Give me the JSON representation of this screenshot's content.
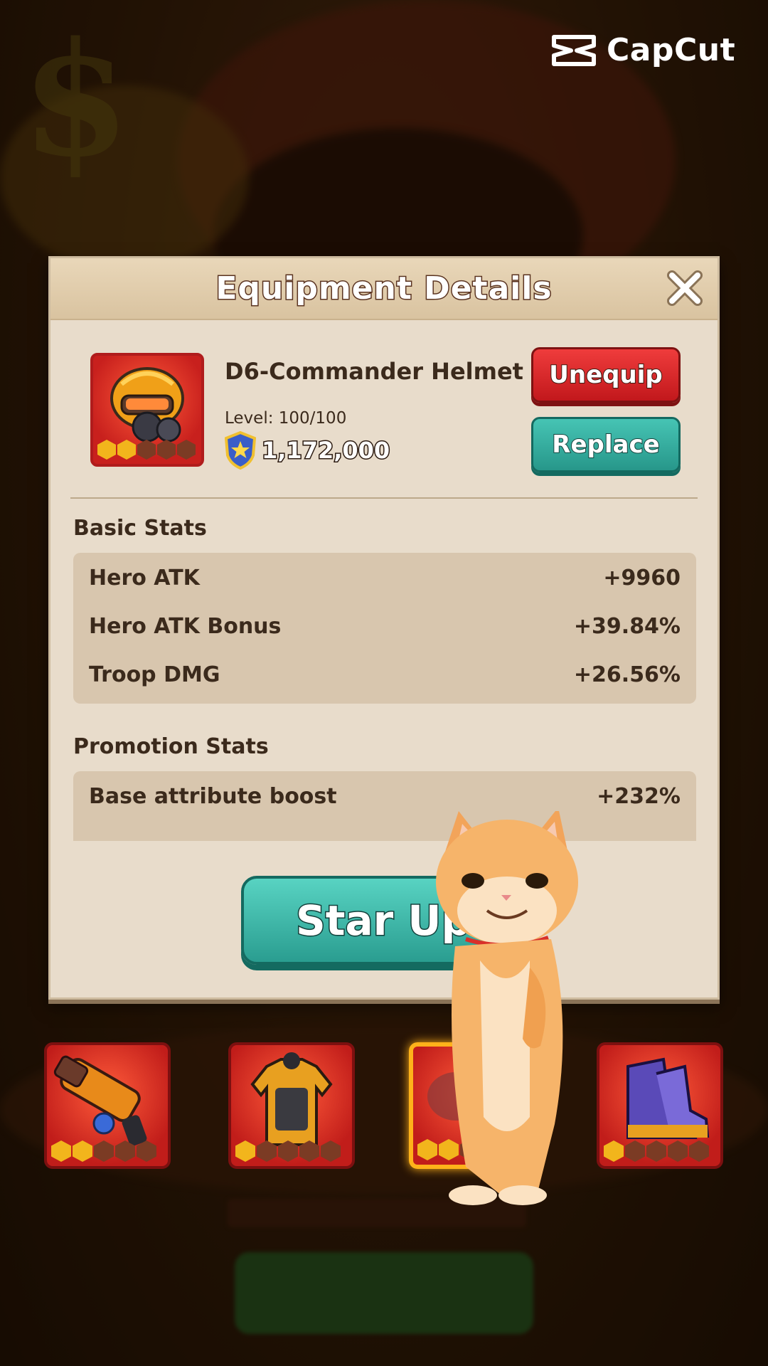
{
  "watermark": {
    "brand": "CapCut",
    "icon": "capcut-logo-icon"
  },
  "dialog": {
    "title": "Equipment Details",
    "close_icon": "close-icon",
    "item": {
      "name": "D6-Commander Helmet",
      "level": "Level: 100/100",
      "power": "1,172,000",
      "power_icon": "shield-star-icon",
      "stars_filled": 2,
      "stars_total": 5
    },
    "buttons": {
      "unequip": "Unequip",
      "replace": "Replace",
      "star_up": "Star Up"
    },
    "basic_stats": {
      "title": "Basic Stats",
      "rows": [
        {
          "label": "Hero ATK",
          "value": "+9960"
        },
        {
          "label": "Hero ATK Bonus",
          "value": "+39.84%"
        },
        {
          "label": "Troop DMG",
          "value": "+26.56%"
        }
      ]
    },
    "promotion_stats": {
      "title": "Promotion Stats",
      "rows": [
        {
          "label": "Base attribute boost",
          "value": "+232%"
        }
      ]
    }
  },
  "slots": [
    {
      "name": "gatling-gun",
      "stars_filled": 2,
      "selected": false
    },
    {
      "name": "armor-vest",
      "stars_filled": 1,
      "selected": false
    },
    {
      "name": "helmet",
      "stars_filled": 2,
      "selected": true
    },
    {
      "name": "boots",
      "stars_filled": 1,
      "selected": false
    }
  ],
  "colors": {
    "panel": "#e8dccb",
    "unequip": "#d62a2a",
    "replace": "#2ea89a",
    "star_up": "#3fbcab",
    "slot_bg": "#d8271f",
    "star_on": "#f2b51c"
  }
}
